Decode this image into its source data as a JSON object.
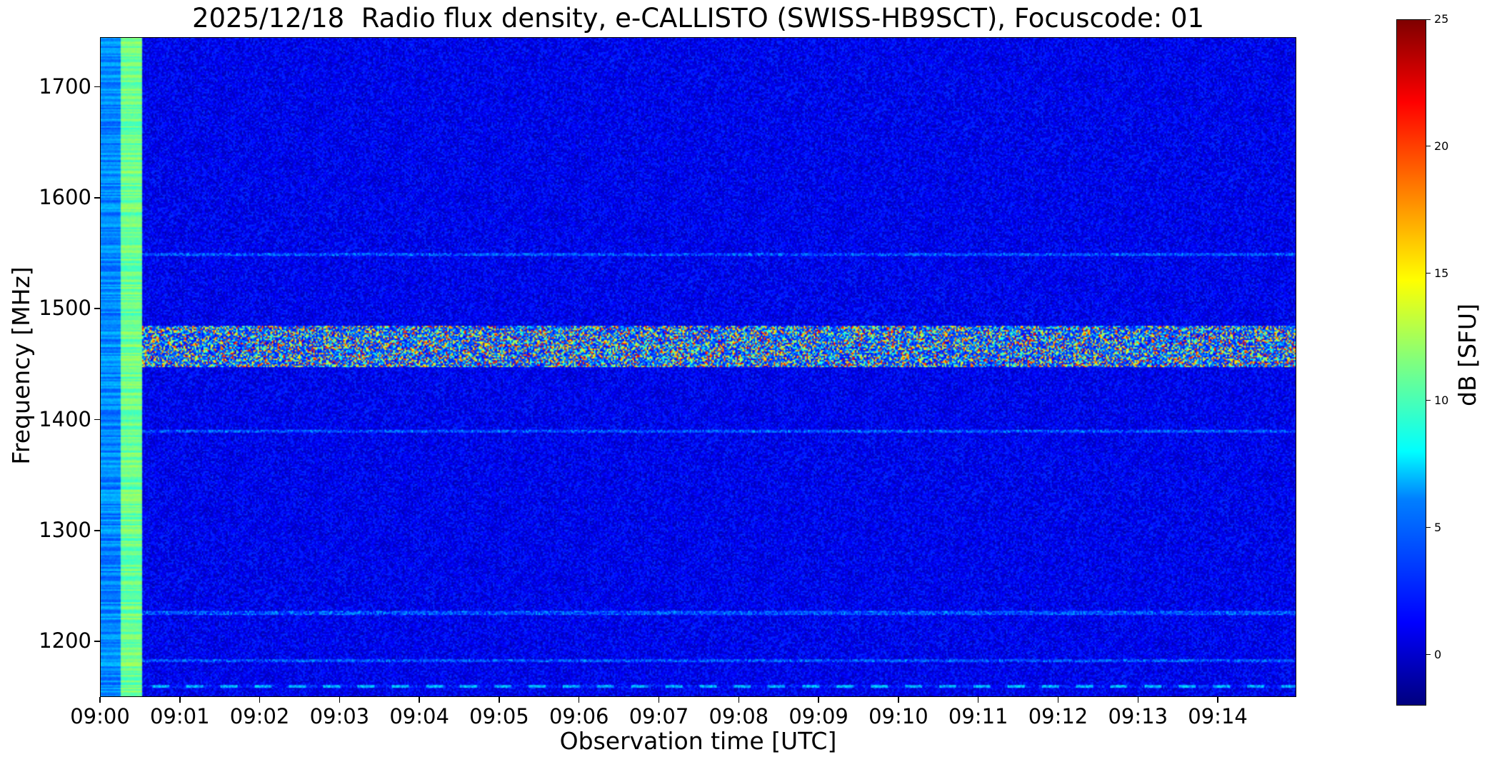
{
  "chart_data": {
    "type": "heatmap",
    "title": "2025/12/18  Radio flux density, e-CALLISTO (SWISS-HB9SCT), Focuscode: 01",
    "xlabel": "Observation time [UTC]",
    "ylabel": "Frequency [MHz]",
    "colorbar_label": "dB [SFU]",
    "colormap": "jet",
    "x_range": [
      "09:00",
      "09:15"
    ],
    "y_range": [
      1150,
      1745
    ],
    "color_range": [
      -2,
      25
    ],
    "x_ticks": [
      "09:00",
      "09:01",
      "09:02",
      "09:03",
      "09:04",
      "09:05",
      "09:06",
      "09:07",
      "09:08",
      "09:09",
      "09:10",
      "09:11",
      "09:12",
      "09:13",
      "09:14"
    ],
    "y_ticks": [
      1200,
      1300,
      1400,
      1500,
      1600,
      1700
    ],
    "colorbar_ticks": [
      0,
      5,
      10,
      15,
      20,
      25
    ],
    "features": {
      "calibration_segments": [
        {
          "time": [
            "09:00:00",
            "09:00:15"
          ],
          "level_db": 5
        },
        {
          "time": [
            "09:00:15",
            "09:00:31"
          ],
          "level_db": 11
        }
      ],
      "background_level_db": 1,
      "interference_band_mhz": [
        1448,
        1485
      ],
      "interference_level_db": [
        5,
        22
      ],
      "narrow_lines_mhz": [
        1160,
        1183,
        1226,
        1390,
        1550
      ]
    }
  }
}
